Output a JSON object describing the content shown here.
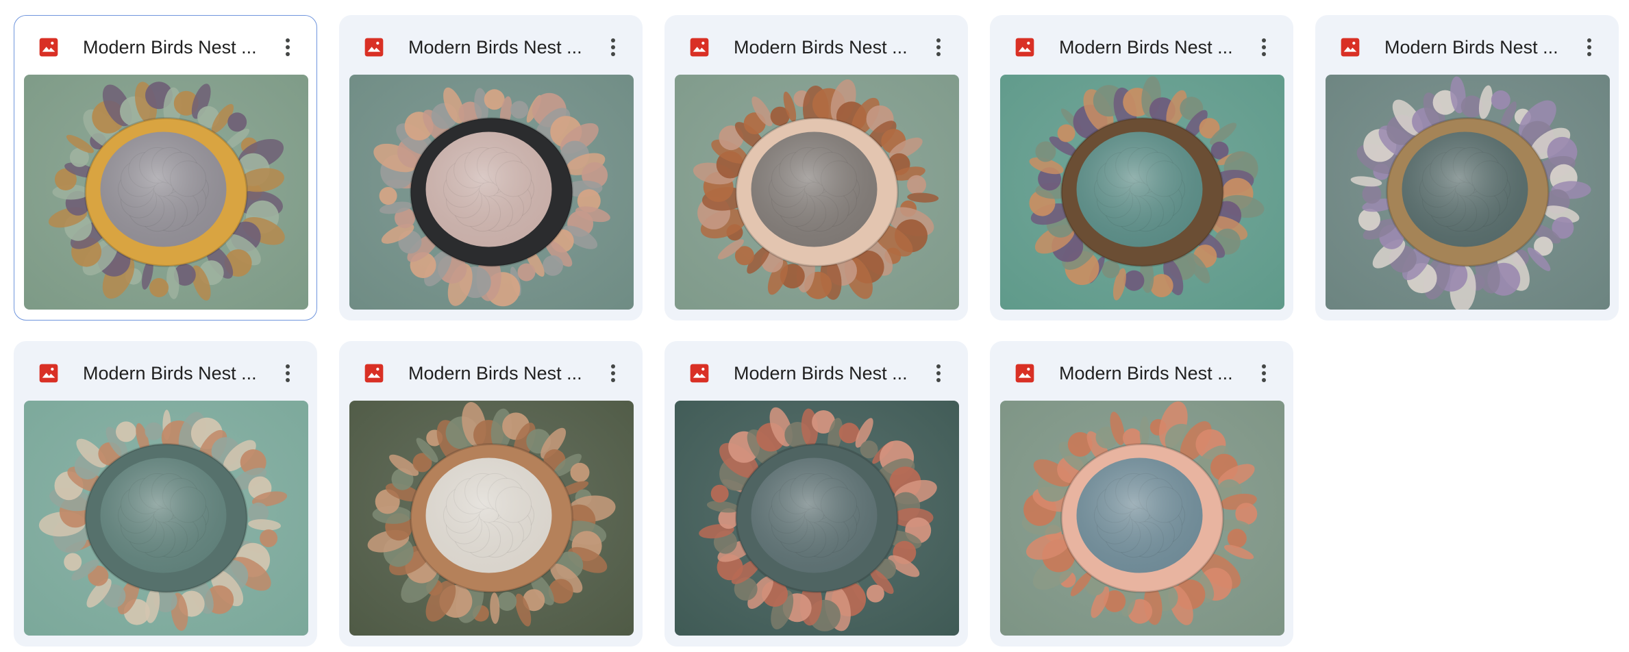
{
  "files": [
    {
      "name": "Modern Birds Nest ...",
      "icon": "image-file-icon",
      "selected": true,
      "bg": "#7d9a86",
      "flowers": "#b58a4e",
      "ring": "#d9a441",
      "center": "#8f8c93",
      "accents": [
        "#d8d2c6",
        "#6f5f76",
        "#9eb29f"
      ]
    },
    {
      "name": "Modern Birds Nest ...",
      "icon": "image-file-icon",
      "selected": false,
      "bg": "#6f8c84",
      "flowers": "#c59a8c",
      "ring": "#2b2c2e",
      "center": "#c7aea8",
      "accents": [
        "#e6d6cc",
        "#9a9c9b",
        "#d6a585"
      ]
    },
    {
      "name": "Modern Birds Nest ...",
      "icon": "image-file-icon",
      "selected": false,
      "bg": "#7f9a8a",
      "flowers": "#b26b42",
      "ring": "#e3c5b0",
      "center": "#7e7874",
      "accents": [
        "#f0e6de",
        "#c49883",
        "#9e5c3a"
      ]
    },
    {
      "name": "Modern Birds Nest ...",
      "icon": "image-file-icon",
      "selected": false,
      "bg": "#5f9a8a",
      "flowers": "#7c8f7d",
      "ring": "#6b4e34",
      "center": "#5a8a84",
      "accents": [
        "#e6c9a2",
        "#6e5a7c",
        "#c98e63"
      ]
    },
    {
      "name": "Modern Birds Nest ...",
      "icon": "image-file-icon",
      "selected": false,
      "bg": "#6c8480",
      "flowers": "#8a7f99",
      "ring": "#a58457",
      "center": "#566a69",
      "accents": [
        "#e09a6f",
        "#d9d2cc",
        "#9b8ab0"
      ]
    },
    {
      "name": "Modern Birds Nest ...",
      "icon": "image-file-icon",
      "selected": false,
      "bg": "#7ba89a",
      "flowers": "#d4c5b0",
      "ring": "#56716c",
      "center": "#60807a",
      "accents": [
        "#e8dccb",
        "#c18a68",
        "#94a69c"
      ]
    },
    {
      "name": "Modern Birds Nest ...",
      "icon": "image-file-icon",
      "selected": false,
      "bg": "#4f5a45",
      "flowers": "#a8714d",
      "ring": "#b5815a",
      "center": "#d9d4cc",
      "accents": [
        "#e8e2d8",
        "#7e8a74",
        "#c89b7b"
      ]
    },
    {
      "name": "Modern Birds Nest ...",
      "icon": "image-file-icon",
      "selected": false,
      "bg": "#3f5a55",
      "flowers": "#b86a55",
      "ring": "#4f6462",
      "center": "#5c6f71",
      "accents": [
        "#e8d8c8",
        "#d69580",
        "#7b7b6a"
      ]
    },
    {
      "name": "Modern Birds Nest ...",
      "icon": "image-file-icon",
      "selected": false,
      "bg": "#7d9484",
      "flowers": "#d8896c",
      "ring": "#e8b4a0",
      "center": "#6f8a96",
      "accents": [
        "#f0b8a0",
        "#8c9a86",
        "#c97a58"
      ]
    }
  ],
  "colors": {
    "card_bg": "#eff3f9",
    "selected_border": "#6f95dd",
    "icon_red": "#d93025",
    "text": "#1f1f1f"
  }
}
